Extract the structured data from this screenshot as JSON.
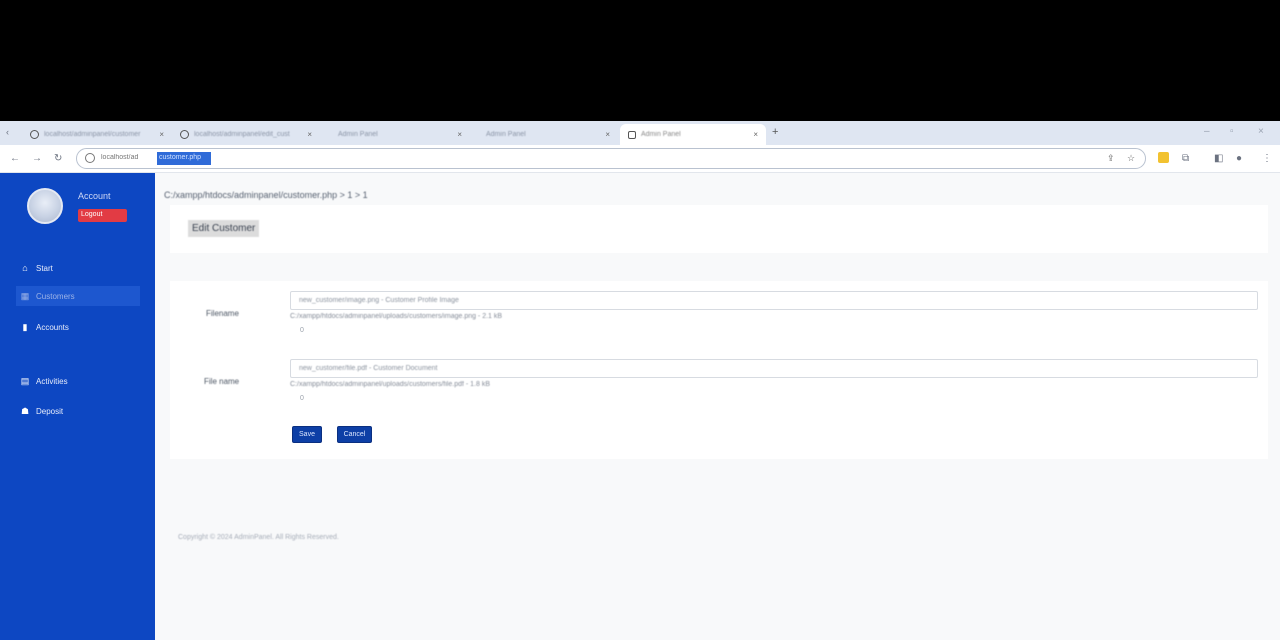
{
  "browser": {
    "tabs": [
      {
        "label": "localhost/adminpanel/customer",
        "has_favicon": true
      },
      {
        "label": "localhost/adminpanel/edit_cust",
        "has_favicon": true
      },
      {
        "label": "Admin Panel",
        "has_favicon": false
      },
      {
        "label": "Admin Panel",
        "has_favicon": false
      },
      {
        "label": "Admin Panel",
        "has_favicon": true
      }
    ],
    "new_tab_glyph": "+",
    "url_prefix": "localhost/ad",
    "url_selected": "customer.php"
  },
  "sidebar": {
    "user_name": "Account",
    "logout_label": "Logout",
    "items": [
      {
        "icon": "home-icon",
        "label": "Start"
      },
      {
        "icon": "grid-icon",
        "label": "Customers"
      },
      {
        "icon": "bag-icon",
        "label": "Accounts"
      },
      {
        "icon": "list-icon",
        "label": "Activities"
      },
      {
        "icon": "user-icon",
        "label": "Deposit"
      }
    ]
  },
  "main": {
    "breadcrumb": "C:/xampp/htdocs/adminpanel/customer.php ",
    "breadcrumb_suffix": "> 1 > 1",
    "page_title": "Edit Customer",
    "fields": [
      {
        "label": "Filename",
        "value": "new_customer/image.png - Customer Profile Image",
        "path": "C:/xampp/htdocs/adminpanel/uploads/customers/image.png - 2.1 kB",
        "path_strong": "2 kB",
        "sub": "0"
      },
      {
        "label": "File name",
        "value": "new_customer/file.pdf - Customer Document",
        "path": "C:/xampp/htdocs/adminpanel/uploads/customers/file.pdf - 1.8 kB",
        "path_strong": "2 kB",
        "sub": "0"
      }
    ],
    "save_label": "Save",
    "cancel_label": "Cancel"
  },
  "footer": {
    "text": "Copyright © 2024 AdminPanel. All Rights Reserved."
  }
}
